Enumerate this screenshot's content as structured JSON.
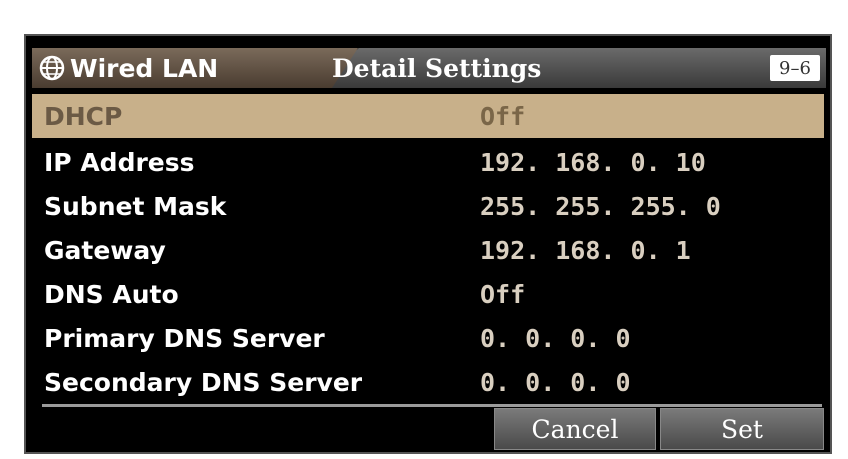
{
  "header": {
    "tab_label": "Wired LAN",
    "title": "Detail Settings",
    "page_badge": "9–6"
  },
  "settings": [
    {
      "label": "DHCP",
      "value": "Off",
      "selected": true
    },
    {
      "label": "IP Address",
      "value": "192. 168. 0. 10",
      "selected": false
    },
    {
      "label": "Subnet Mask",
      "value": "255. 255. 255. 0",
      "selected": false
    },
    {
      "label": "Gateway",
      "value": "192. 168. 0. 1",
      "selected": false
    },
    {
      "label": "DNS Auto",
      "value": "Off",
      "selected": false
    },
    {
      "label": "Primary DNS Server",
      "value": "0. 0. 0. 0",
      "selected": false
    },
    {
      "label": "Secondary DNS Server",
      "value": "0. 0. 0. 0",
      "selected": false
    }
  ],
  "buttons": {
    "cancel": "Cancel",
    "set": "Set"
  },
  "colors": {
    "selected_row": "#c8b08a",
    "background": "#000000"
  }
}
